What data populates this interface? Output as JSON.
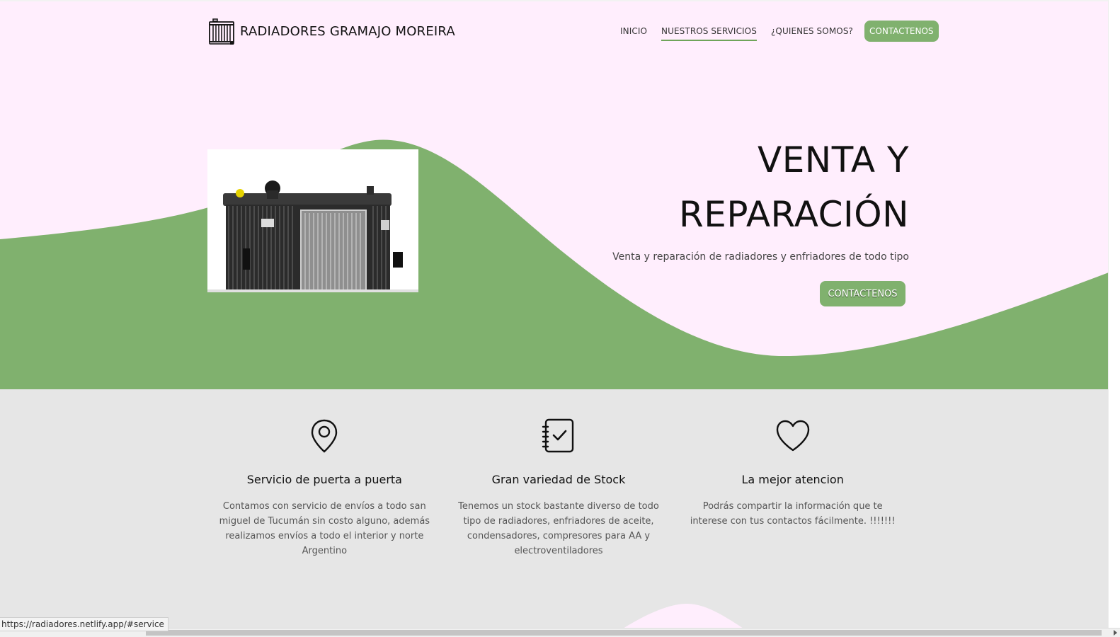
{
  "brand": {
    "name": "RADIADORES GRAMAJO MOREIRA",
    "icon": "radiator-icon"
  },
  "nav": {
    "items": [
      {
        "label": "INICIO",
        "active": false
      },
      {
        "label": "NUESTROS SERVICIOS",
        "active": true
      },
      {
        "label": "¿QUIENES SOMOS?",
        "active": false
      }
    ],
    "cta": "CONTACTENOS"
  },
  "hero": {
    "title_line1": "VENTA Y",
    "title_line2": "REPARACIÓN",
    "subtitle": "Venta y reparación de radiadores y enfriadores de todo tipo",
    "cta": "CONTACTENOS",
    "image": "radiator-photo"
  },
  "features": [
    {
      "icon": "location-pin-icon",
      "title": "Servicio de puerta a puerta",
      "text": "Contamos con servicio de envíos a todo san miguel de Tucumán sin costo alguno, además realizamos envíos a todo el interior y norte Argentino"
    },
    {
      "icon": "checklist-notebook-icon",
      "title": "Gran variedad de Stock",
      "text": "Tenemos un stock bastante diverso de todo tipo de radiadores, enfriadores de aceite, condensadores, compresores para AA y electroventiladores"
    },
    {
      "icon": "heart-icon",
      "title": "La mejor atencion",
      "text": "Podrás compartir la información que te interese con tus contactos fácilmente. !!!!!!!"
    }
  ],
  "status_bar": {
    "url": "https://radiadores.netlify.app/#service"
  },
  "colors": {
    "accent": "#80b16e",
    "hero_bg": "#ffeefd",
    "section_bg": "#e6e6e6"
  }
}
